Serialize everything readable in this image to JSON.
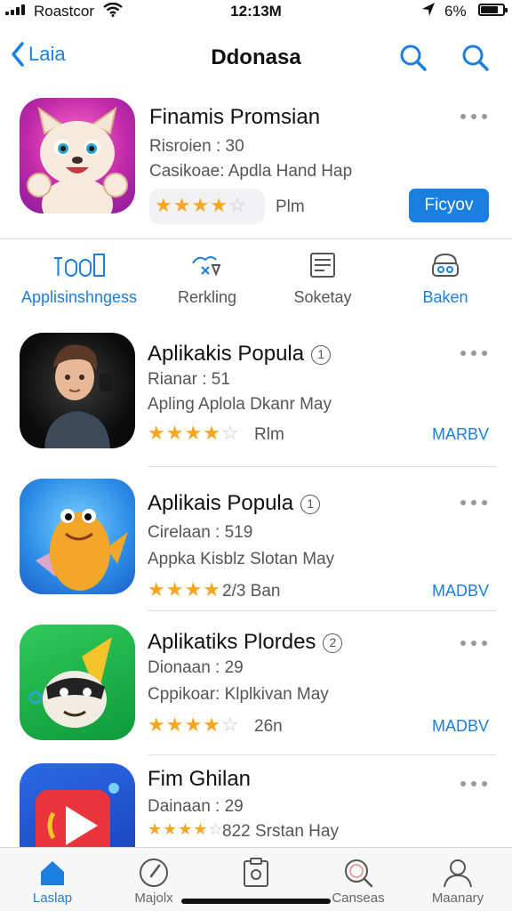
{
  "status": {
    "carrier": "Roastcor",
    "time": "12:13M",
    "battery": "6%"
  },
  "header": {
    "back_label": "Laia",
    "title": "Ddonasa"
  },
  "featured": {
    "name": "Finamis Promsian",
    "line1": "Risroien : 30",
    "line2": "Casikoae: Apdla Hand Hap",
    "rating": 4,
    "rating_text": "Plm",
    "button": "Ficyov"
  },
  "categories": [
    {
      "label": "Applisinshngess",
      "icon": "apps-icon",
      "color": "#1a7fe0"
    },
    {
      "label": "Rerkling",
      "icon": "ranking-icon",
      "color": "#555555"
    },
    {
      "label": "Soketay",
      "icon": "document-icon",
      "color": "#555555"
    },
    {
      "label": "Baken",
      "icon": "bag-icon",
      "color": "#1a7fe0"
    }
  ],
  "apps": [
    {
      "name": "Aplikakis Popula",
      "badge": "1",
      "line1": "Rianar : 51",
      "line2": "Apling Aplola Dkanr May",
      "rating": 4,
      "rating_text": "Rlm",
      "action": "MARBV"
    },
    {
      "name": "Aplikais Popula",
      "badge": "1",
      "line1": "Cirelaan : 519",
      "line2": "Appka Kisblz Slotan May",
      "rating": 4,
      "rating_text": "2/3  Ban",
      "action": "MADBV"
    },
    {
      "name": "Aplikatiks Plordes",
      "badge": "2",
      "line1": "Dionaan : 29",
      "line2": "Cppikoar: Klplkivan May",
      "rating": 4,
      "rating_text": "26n",
      "action": "MADBV"
    },
    {
      "name": "Fim Ghilan",
      "badge": "",
      "line1": "Dainaan : 29",
      "line2": "822 Srstan Hay",
      "rating": 4,
      "rating_text": "",
      "action": ""
    }
  ],
  "tabs": [
    {
      "label": "Laslap",
      "icon": "home-icon"
    },
    {
      "label": "Majolx",
      "icon": "compass-icon"
    },
    {
      "label": "",
      "icon": "clipboard-icon"
    },
    {
      "label": "Canseas",
      "icon": "search-icon"
    },
    {
      "label": "Maanary",
      "icon": "profile-icon"
    }
  ],
  "colors": {
    "accent": "#1a7fe0",
    "star": "#f5a623"
  }
}
